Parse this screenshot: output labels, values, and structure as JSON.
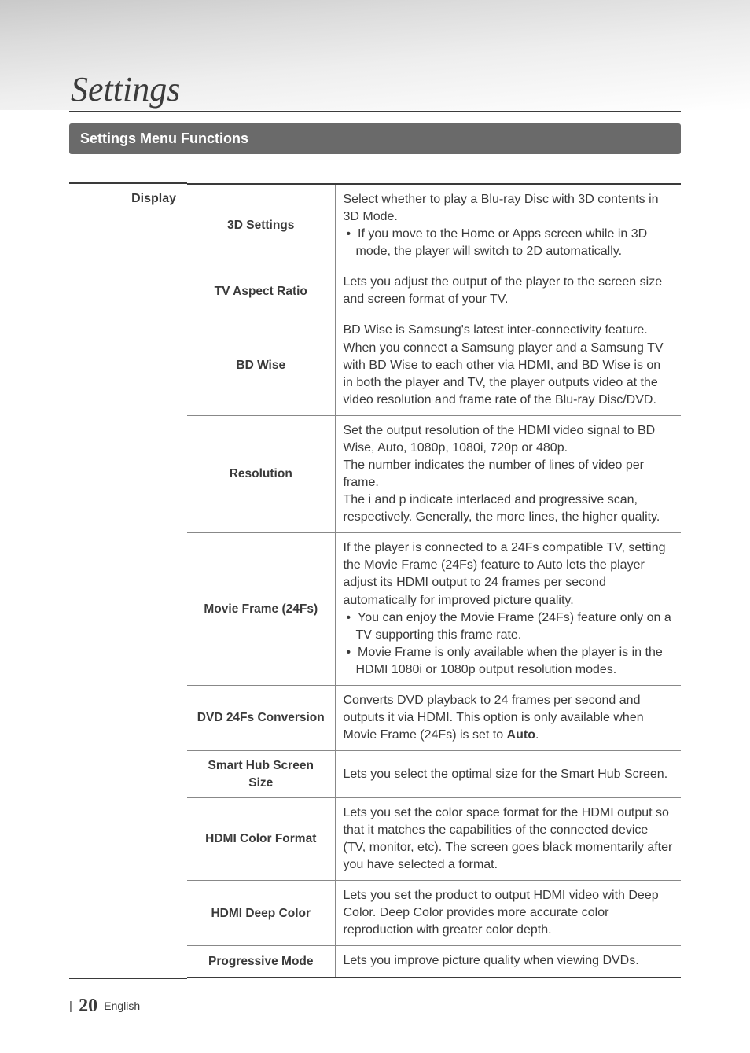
{
  "chapterTitle": "Settings",
  "sectionHeading": "Settings Menu Functions",
  "category": "Display",
  "rows": [
    {
      "name": "3D Settings",
      "desc_plain": "Select whether to play a Blu-ray Disc with 3D contents in 3D Mode.",
      "bullets": [
        "If you move to the Home or Apps screen while in 3D mode, the player will switch to 2D automatically."
      ]
    },
    {
      "name": "TV Aspect Ratio",
      "desc_plain": "Lets you adjust the output of the player to the screen size and screen format of your TV."
    },
    {
      "name": "BD Wise",
      "desc_plain": "BD Wise is Samsung's latest inter-connectivity feature. When you connect a Samsung player and a Samsung TV with BD Wise to each other via HDMI, and BD Wise is on in both the player and TV, the player outputs video at the video resolution and frame rate of the Blu-ray Disc/DVD."
    },
    {
      "name": "Resolution",
      "lines": [
        "Set the output resolution of the HDMI video signal to BD Wise, Auto, 1080p, 1080i, 720p or 480p.",
        "The number indicates the number of lines of video per frame.",
        "The i and p indicate interlaced and progressive scan, respectively. Generally, the more lines, the higher quality."
      ]
    },
    {
      "name": "Movie Frame (24Fs)",
      "desc_plain": "If the player is connected to a 24Fs compatible TV, setting the Movie Frame (24Fs) feature to Auto lets the player adjust its HDMI output to 24 frames per second automatically for improved picture quality.",
      "bullets": [
        "You can enjoy the Movie Frame (24Fs) feature only on a TV supporting this frame rate.",
        "Movie Frame is only available when the player is in the HDMI 1080i or 1080p output resolution modes."
      ]
    },
    {
      "name": "DVD 24Fs Conversion",
      "desc_pre": "Converts DVD playback to 24 frames per second and outputs it via HDMI. This option is only available when Movie Frame (24Fs) is set to ",
      "desc_bold": "Auto",
      "desc_post": "."
    },
    {
      "name": "Smart Hub Screen Size",
      "desc_plain": "Lets you select the optimal size for the Smart Hub Screen."
    },
    {
      "name": "HDMI Color Format",
      "desc_plain": "Lets you set the color space format for the HDMI output so that it matches the capabilities of the connected device (TV, monitor, etc). The screen goes black momentarily after you have selected a format."
    },
    {
      "name": "HDMI Deep Color",
      "desc_plain": "Lets you set the product to output HDMI video with Deep Color. Deep Color provides more accurate color reproduction with greater color depth."
    },
    {
      "name": "Progressive Mode",
      "desc_plain": "Lets you improve picture quality when viewing DVDs."
    }
  ],
  "footer": {
    "pipe": "|",
    "pageNumber": "20",
    "lang": "English"
  }
}
